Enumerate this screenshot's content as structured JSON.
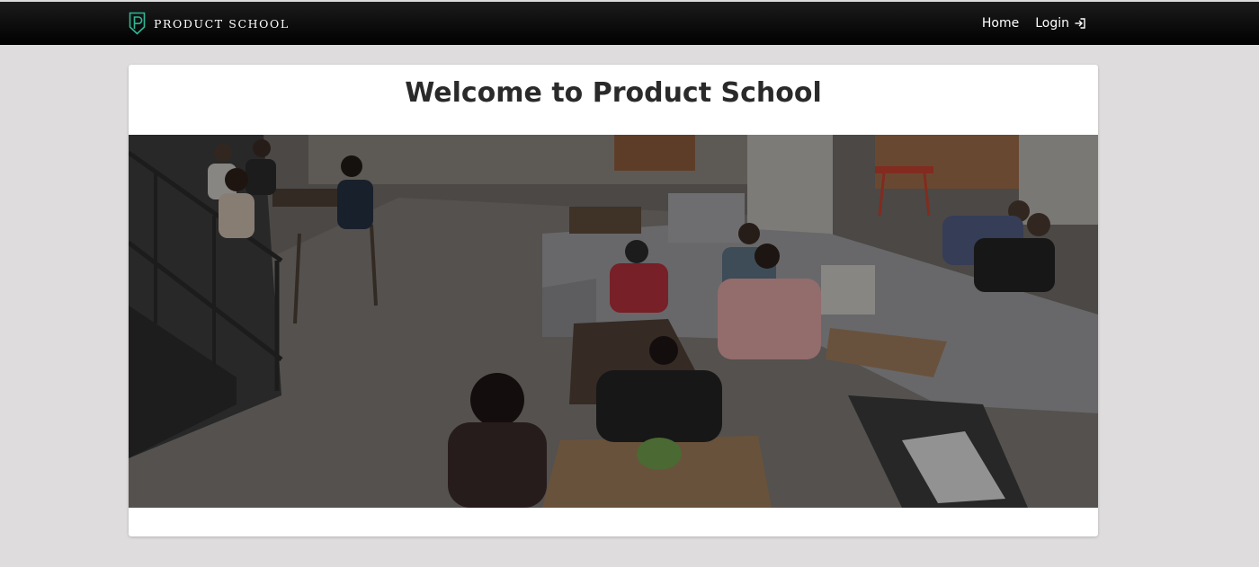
{
  "nav": {
    "brand_text": "PRODUCT SCHOOL",
    "links": [
      {
        "label": "Home"
      },
      {
        "label": "Login"
      }
    ]
  },
  "main": {
    "title": "Welcome to Product School"
  },
  "icons": {
    "brand_logo": "shield-p-logo-icon",
    "login": "sign-in-arrow-icon"
  },
  "colors": {
    "navbar": "#000000",
    "page_background": "#dedcdc",
    "card": "#ffffff",
    "title_text": "#2a2a2a",
    "logo_accent": "#2db894"
  }
}
